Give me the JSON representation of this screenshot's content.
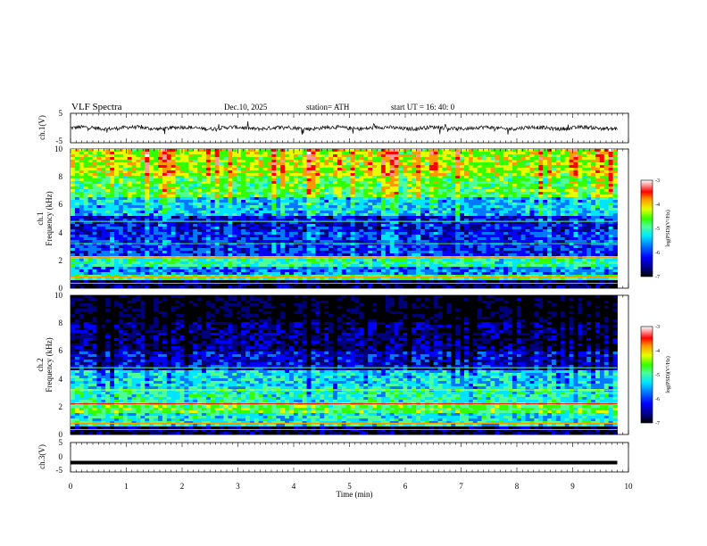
{
  "header": {
    "title": "VLF  Spectra",
    "date": "Dec.10, 2025",
    "station": "station= ATH",
    "start_ut": "start  UT  =   16: 40: 0"
  },
  "colors": {
    "axis": "#000000",
    "trace": "#000000",
    "colormap": [
      "#000000",
      "#00007a",
      "#0000ff",
      "#0078ff",
      "#00e5ff",
      "#4dff99",
      "#33ff00",
      "#e5ff00",
      "#ff9900",
      "#ff0000",
      "#ff9999",
      "#ffffff"
    ]
  },
  "chart_data": [
    {
      "type": "line",
      "panel": "ch1-waveform",
      "ylabel": "ch.1(V)",
      "ylim": [
        -5,
        5
      ],
      "yticks": [
        "5",
        "-5"
      ],
      "baseline_value": 0,
      "amplitude_approx": 0.8,
      "xlim": [
        0,
        10
      ]
    },
    {
      "type": "heatmap",
      "panel": "ch1-spectrogram",
      "ylabel_line1": "ch.1",
      "ylabel_line2": "Frequency  (kHz)",
      "ylim": [
        0,
        10
      ],
      "yticks": [
        "10",
        "8",
        "6",
        "4",
        "2",
        "0"
      ],
      "xlim": [
        0,
        9.8
      ],
      "colorbar": {
        "label": "log(PSD)(V²/Hz)",
        "range": [
          -7,
          -3
        ],
        "ticks": [
          "-3",
          "-4",
          "-5",
          "-6",
          "-7"
        ]
      },
      "bands": [
        {
          "from": 0,
          "to": 0.5,
          "level": -6.8
        },
        {
          "from": 0.5,
          "to": 1.0,
          "level": -5.2
        },
        {
          "from": 1.0,
          "to": 1.6,
          "level": -5.9
        },
        {
          "from": 1.6,
          "to": 2.4,
          "level": -5.3
        },
        {
          "from": 2.4,
          "to": 4.0,
          "level": -6.2
        },
        {
          "from": 4.0,
          "to": 5.2,
          "level": -6.4
        },
        {
          "from": 5.2,
          "to": 6.6,
          "level": -5.7
        },
        {
          "from": 6.6,
          "to": 8.0,
          "level": -5.0
        },
        {
          "from": 8.0,
          "to": 10.0,
          "level": -4.6
        }
      ]
    },
    {
      "type": "heatmap",
      "panel": "ch2-spectrogram",
      "ylabel_line1": "ch.2",
      "ylabel_line2": "Frequency  (kHz)",
      "ylim": [
        0,
        10
      ],
      "yticks": [
        "10",
        "8",
        "6",
        "4",
        "2",
        "0"
      ],
      "xlim": [
        0,
        9.8
      ],
      "colorbar": {
        "label": "log(PSD)(V²/Hz)",
        "range": [
          -7,
          -3
        ],
        "ticks": [
          "-3",
          "-4",
          "-5",
          "-6",
          "-7"
        ]
      },
      "bands": [
        {
          "from": 0,
          "to": 0.6,
          "level": -6.8
        },
        {
          "from": 0.6,
          "to": 1.6,
          "level": -5.4
        },
        {
          "from": 1.6,
          "to": 2.4,
          "level": -4.9
        },
        {
          "from": 2.4,
          "to": 3.2,
          "level": -5.3
        },
        {
          "from": 3.2,
          "to": 4.6,
          "level": -5.5
        },
        {
          "from": 4.6,
          "to": 6.0,
          "level": -6.3
        },
        {
          "from": 6.0,
          "to": 8.0,
          "level": -6.6
        },
        {
          "from": 8.0,
          "to": 10.0,
          "level": -6.9
        }
      ]
    },
    {
      "type": "line",
      "panel": "ch3-waveform",
      "ylabel": "ch.3(V)",
      "ylim": [
        -5,
        5
      ],
      "yticks": [
        "5",
        "0",
        "-5"
      ],
      "baseline_value": -1.8,
      "xlim": [
        0,
        9.8
      ]
    }
  ],
  "x_axis": {
    "label": "Time  (min)",
    "range": [
      0,
      10
    ],
    "ticks": [
      "0",
      "1",
      "2",
      "3",
      "4",
      "5",
      "6",
      "7",
      "8",
      "9",
      "10"
    ]
  }
}
